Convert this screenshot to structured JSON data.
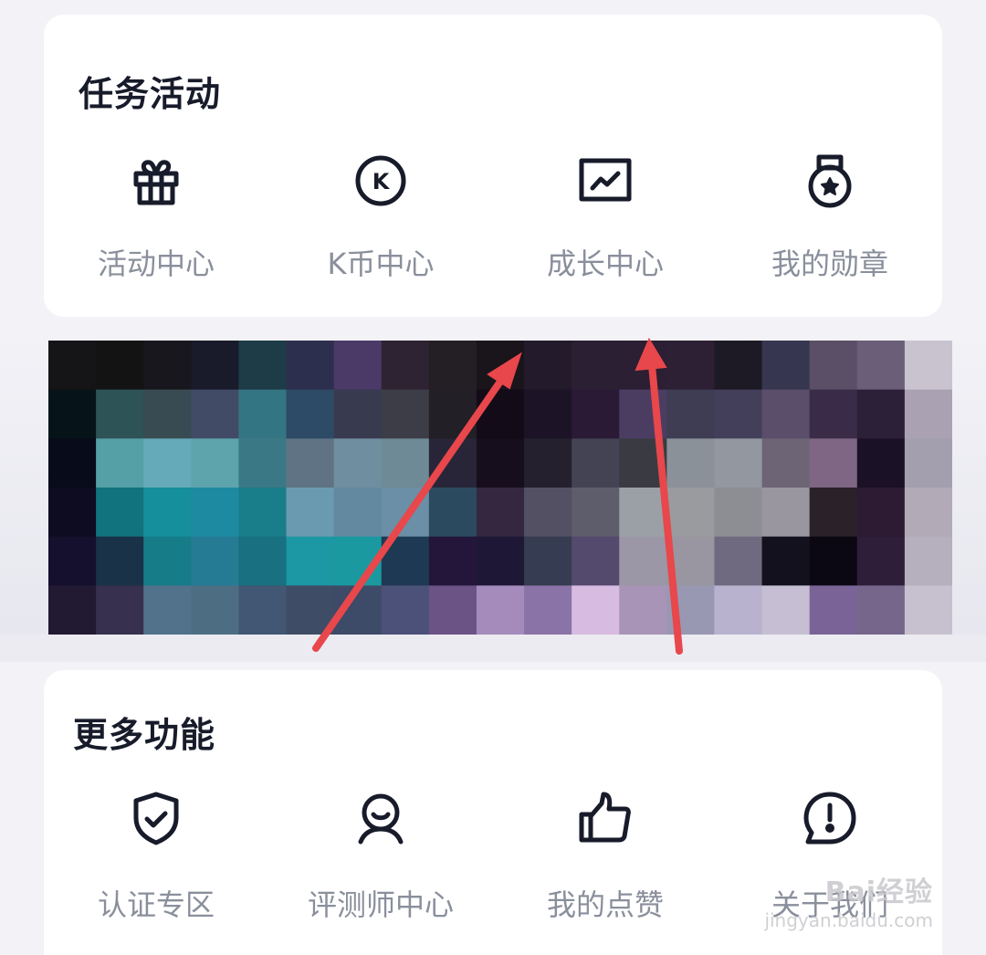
{
  "task_section": {
    "title": "任务活动",
    "items": [
      {
        "label": "活动中心",
        "icon": "gift-icon"
      },
      {
        "label": "K币中心",
        "icon": "k-coin-icon"
      },
      {
        "label": "成长中心",
        "icon": "growth-chart-icon"
      },
      {
        "label": "我的勋章",
        "icon": "medal-icon"
      }
    ]
  },
  "more_section": {
    "title": "更多功能",
    "items": [
      {
        "label": "认证专区",
        "icon": "shield-check-icon"
      },
      {
        "label": "评测师中心",
        "icon": "reviewer-icon"
      },
      {
        "label": "我的点赞",
        "icon": "thumbs-up-icon"
      },
      {
        "label": "关于我们",
        "icon": "info-bubble-icon"
      }
    ]
  },
  "watermark": {
    "main": "Bai经验",
    "sub": "jingyan.baidu.com"
  },
  "colors": {
    "background": "#f2f2f7",
    "card": "#ffffff",
    "title": "#171b2a",
    "label": "#8a8f9c",
    "icon": "#171b2a",
    "arrow": "#e8474b"
  }
}
